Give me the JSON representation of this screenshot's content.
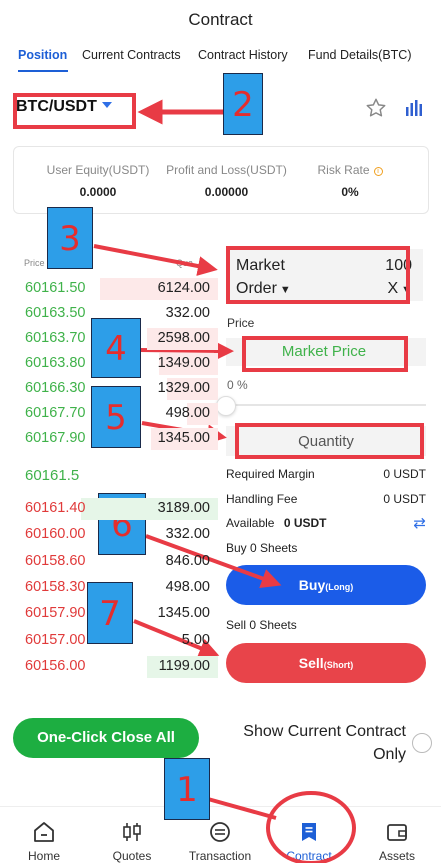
{
  "header": {
    "title": "Contract"
  },
  "tabs": [
    {
      "label": "Position",
      "active": true
    },
    {
      "label": "Current Contracts",
      "active": false
    },
    {
      "label": "Contract History",
      "active": false
    },
    {
      "label": "Fund Details(BTC)",
      "active": false
    }
  ],
  "pair": {
    "symbol": "BTC/USDT"
  },
  "icons": {
    "favorite": "star-outline-icon",
    "chart": "kline-bars-icon"
  },
  "stats": [
    {
      "label": "User Equity(USDT)",
      "value": "0.0000"
    },
    {
      "label": "Profit and Loss(USDT)",
      "value": "0.00000"
    },
    {
      "label": "Risk Rate",
      "value": "0%",
      "info_icon": "info-icon"
    }
  ],
  "orderbook": {
    "price_header": "Price",
    "qty_header": "Qua",
    "asks": [
      {
        "price": "60161.50",
        "qty": "6124.00"
      },
      {
        "price": "60163.50",
        "qty": "332.00"
      },
      {
        "price": "60163.70",
        "qty": "2598.00"
      },
      {
        "price": "60163.80",
        "qty": "1349.00"
      },
      {
        "price": "60166.30",
        "qty": "1329.00"
      },
      {
        "price": "60167.70",
        "qty": "498.00"
      },
      {
        "price": "60167.90",
        "qty": "1345.00"
      }
    ],
    "last_price": "60161.5",
    "bids": [
      {
        "price": "60161.40",
        "qty": "3189.00"
      },
      {
        "price": "60160.00",
        "qty": "332.00"
      },
      {
        "price": "60158.60",
        "qty": "846.00"
      },
      {
        "price": "60158.30",
        "qty": "498.00"
      },
      {
        "price": "60157.90",
        "qty": "1345.00"
      },
      {
        "price": "60157.00",
        "qty": "5.00"
      },
      {
        "price": "60156.00",
        "qty": "1199.00"
      }
    ]
  },
  "order_form": {
    "order_type_line1": "Market",
    "order_type_line2": "Order",
    "leverage_value": "100",
    "leverage_unit": "X",
    "price_label": "Price",
    "price_placeholder": "Market Price",
    "slider_percent": "0 %",
    "quantity_placeholder": "Quantity",
    "required_margin_label": "Required Margin",
    "required_margin_value": "0 USDT",
    "handling_fee_label": "Handling Fee",
    "handling_fee_value": "0 USDT",
    "available_label": "Available",
    "available_value": "0 USDT",
    "buy_sheets": "Buy  0 Sheets",
    "buy_label": "Buy",
    "buy_sub": "(Long)",
    "sell_sheets": "Sell 0 Sheets",
    "sell_label": "Sell",
    "sell_sub": "(Short)"
  },
  "footer_actions": {
    "close_all": "One-Click Close All",
    "show_current_line1": "Show Current Contract",
    "show_current_line2": "Only"
  },
  "bottom_nav": [
    {
      "label": "Home",
      "icon": "home-icon",
      "active": false
    },
    {
      "label": "Quotes",
      "icon": "candlestick-icon",
      "active": false
    },
    {
      "label": "Transaction",
      "icon": "exchange-icon",
      "active": false
    },
    {
      "label": "Contract",
      "icon": "contract-icon",
      "active": true
    },
    {
      "label": "Assets",
      "icon": "wallet-icon",
      "active": false
    }
  ],
  "annotations": {
    "steps": [
      "1",
      "2",
      "3",
      "4",
      "5",
      "6",
      "7"
    ],
    "color": "#e83b45",
    "badge_color": "#2d9ee8"
  },
  "colors": {
    "blue": "#1b5ce8",
    "red": "#e8444a",
    "green": "#3fb24a"
  }
}
